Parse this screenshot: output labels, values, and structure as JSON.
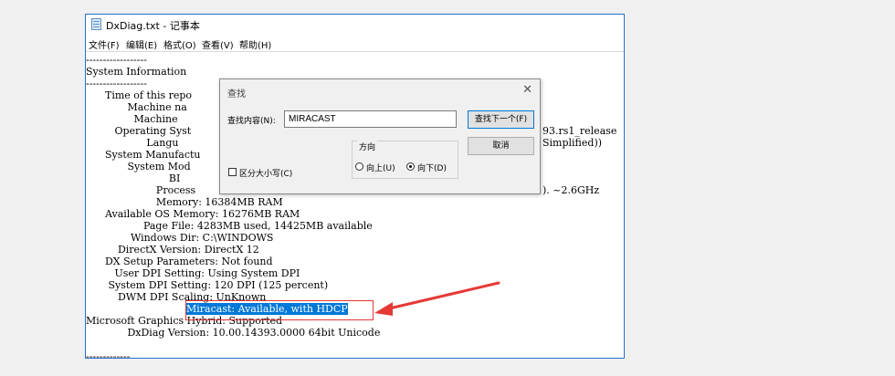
{
  "window": {
    "title": "DxDiag.txt - 记事本"
  },
  "menu": [
    {
      "label": "文件(F)"
    },
    {
      "label": "编辑(E)"
    },
    {
      "label": "格式(O)"
    },
    {
      "label": "查看(V)"
    },
    {
      "label": "帮助(H)"
    }
  ],
  "content": {
    "lines": [
      "------------------",
      "System Information",
      "------------------",
      "      Time of this repo",
      "             Machine na",
      "               Machine",
      "         Operating Syst",
      "                   Langu",
      "      System Manufactu",
      "             System Mod",
      "                          BI",
      "                      Process",
      "                      Memory: 16384MB RAM",
      "      Available OS Memory: 16276MB RAM",
      "                  Page File: 4283MB used, 14425MB available",
      "              Windows Dir: C:\\WINDOWS",
      "          DirectX Version: DirectX 12",
      "      DX Setup Parameters: Not found",
      "         User DPI Setting: Using System DPI",
      "       System DPI Setting: 120 DPI (125 percent)",
      "          DWM DPI Scaling: UnKnown",
      "                             ",
      "Microsoft Graphics Hybrid: Supported",
      "             DxDiag Version: 10.00.14393.0000 64bit Unicode",
      "",
      "-------------"
    ],
    "miracast_line": "Miracast: Available, with HDCP",
    "right_fragments": [
      "93.rs1_release",
      "Simplified))",
      "). ~2.6GHz"
    ]
  },
  "find_dialog": {
    "title": "查找",
    "close_icon": "close-icon",
    "find_label": "查找内容(N):",
    "find_value": "MIRACAST",
    "find_next_button": "查找下一个(F)",
    "cancel_button": "取消",
    "direction_label": "方向",
    "direction_up": "向上(U)",
    "direction_down": "向下(D)",
    "selected_direction": "down",
    "match_case_label": "区分大小写(C)",
    "match_case_checked": false
  },
  "annotation": {
    "color": "#e53935"
  },
  "colors": {
    "selection": "#0078d7",
    "window_border": "#2b6fc9"
  }
}
